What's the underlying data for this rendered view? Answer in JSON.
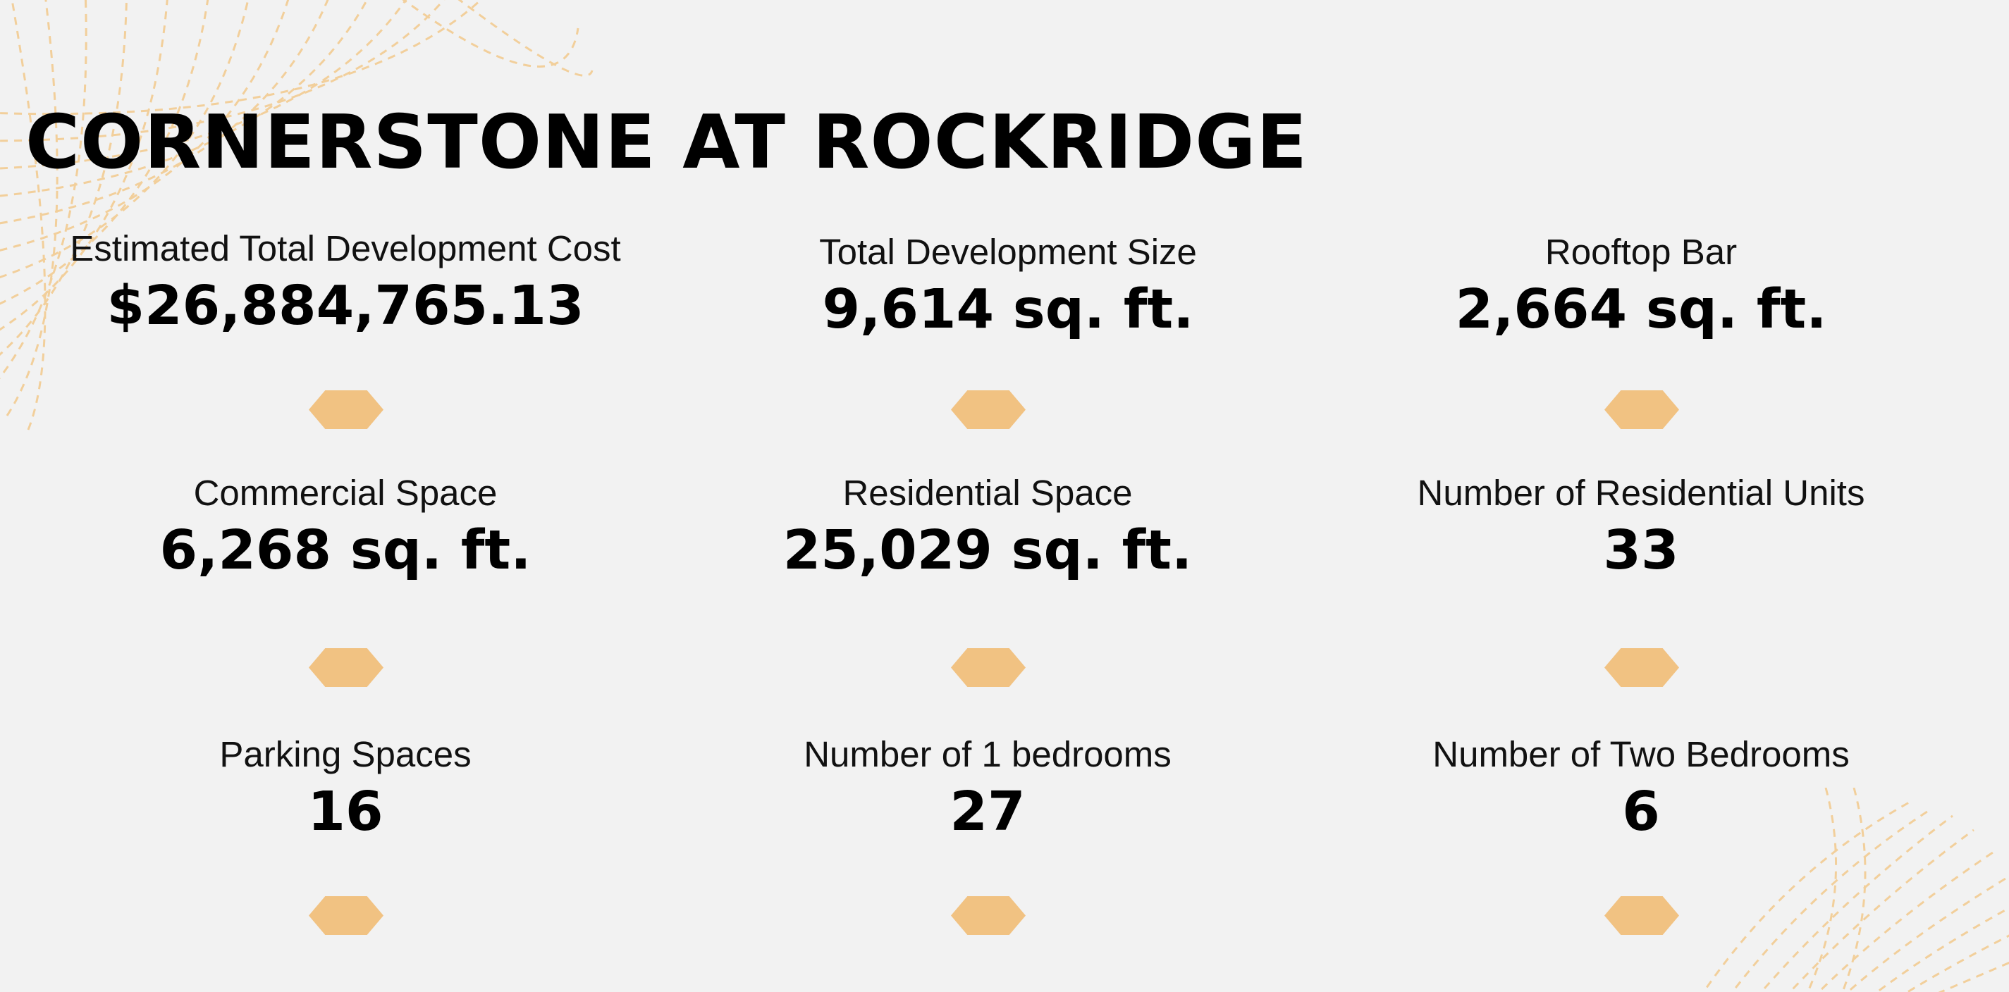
{
  "title": "CORNERSTONE AT ROCKRIDGE",
  "colors": {
    "background": "#f2f2f2",
    "accent": "#f1c282",
    "text": "#000000"
  },
  "stats": [
    {
      "label": "Estimated Total Development Cost",
      "value": "$26,884,765.13"
    },
    {
      "label": "Total Development Size",
      "value": "9,614 sq. ft."
    },
    {
      "label": "Rooftop Bar",
      "value": "2,664 sq. ft."
    },
    {
      "label": "Commercial Space",
      "value": "6,268 sq. ft."
    },
    {
      "label": "Residential Space",
      "value": "25,029 sq. ft."
    },
    {
      "label": "Number of Residential Units",
      "value": "33"
    },
    {
      "label": "Parking Spaces",
      "value": "16"
    },
    {
      "label": "Number of 1 bedrooms",
      "value": "27"
    },
    {
      "label": "Number of Two Bedrooms",
      "value": "6"
    }
  ]
}
